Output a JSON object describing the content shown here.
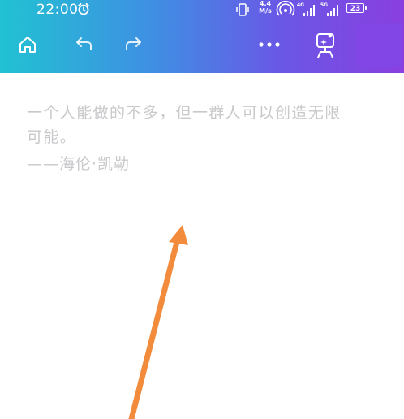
{
  "status_bar": {
    "time": "22:00",
    "net_speed_value": "4.4",
    "net_speed_unit": "M/s",
    "network_tag_1": "4G",
    "network_tag_2": "5G",
    "battery_level": "23",
    "icons": [
      "alarm-icon",
      "vibrate-icon",
      "hotspot-icon",
      "signal-icon",
      "signal-icon",
      "battery-icon"
    ]
  },
  "toolbar": {
    "icons": [
      "home-icon",
      "undo-icon",
      "redo-icon",
      "more-icon",
      "ai-assistant-icon"
    ],
    "accent_gradient": [
      "#21c2d2",
      "#3f8fe3",
      "#6a57e6",
      "#8a3fe0"
    ],
    "avatar_color": "#8246e6"
  },
  "content": {
    "quote": "一个人能做的不多，但一群人可以创造无限\n可能。",
    "attribution": "——海伦·凯勒",
    "text_color": "#c9c9cc"
  },
  "annotation": {
    "arrow_color": "#f28c3c"
  }
}
